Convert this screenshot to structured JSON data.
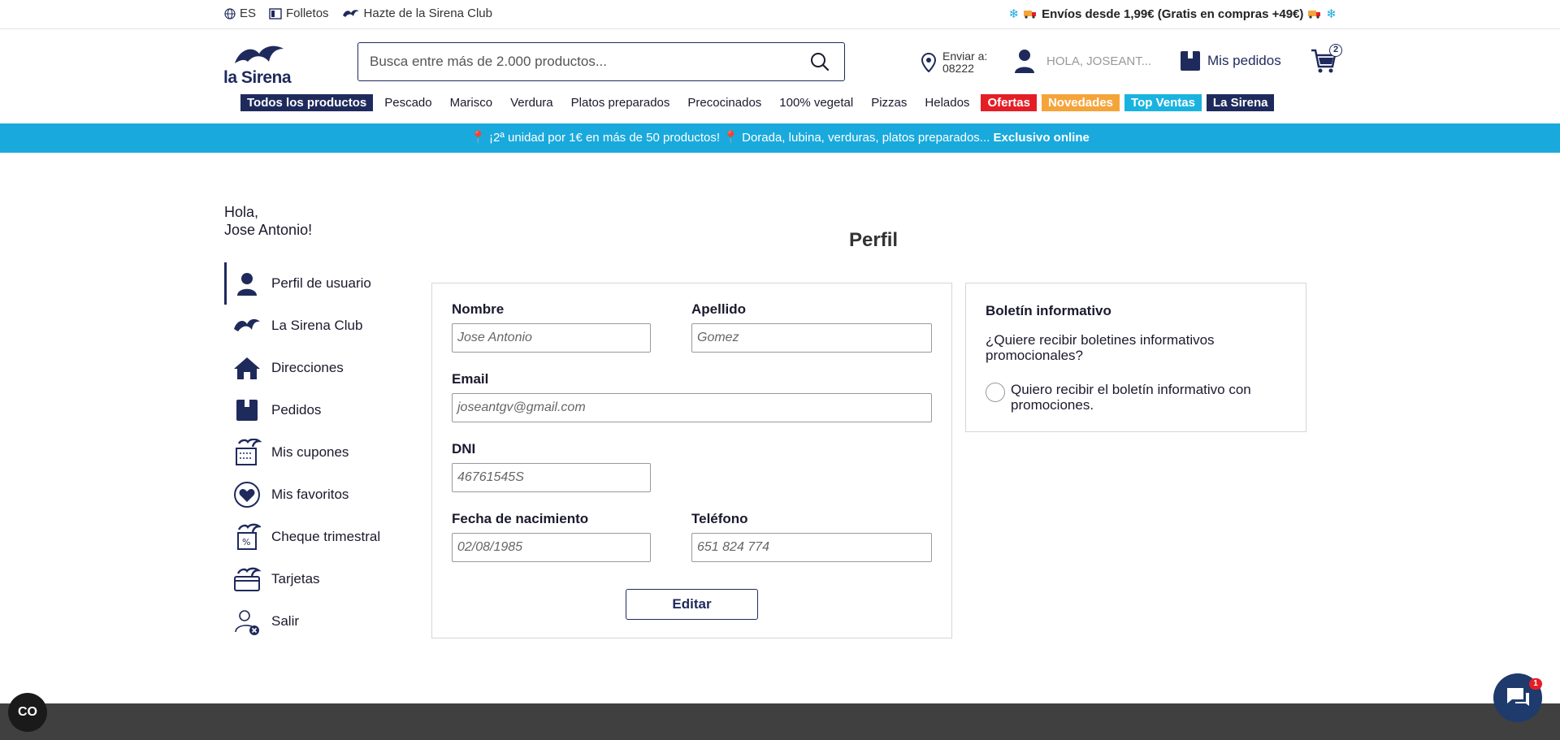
{
  "topbar": {
    "language": "ES",
    "folletos": "Folletos",
    "club_link": "Hazte de la Sirena Club",
    "shipping_prefix": "Envíos desde 1,99€ (Gratis en compras +49€)"
  },
  "header": {
    "logo_text": "la Sirena",
    "search_placeholder": "Busca entre más de 2.000 productos...",
    "ship_label": "Enviar a:",
    "ship_zip": "08222",
    "user_greeting": "HOLA, JOSEANT...",
    "orders_label": "Mis pedidos",
    "cart_count": "2"
  },
  "categories": [
    {
      "label": "Todos los productos",
      "style": "dark"
    },
    {
      "label": "Pescado",
      "style": "plain"
    },
    {
      "label": "Marisco",
      "style": "plain"
    },
    {
      "label": "Verdura",
      "style": "plain"
    },
    {
      "label": "Platos preparados",
      "style": "plain"
    },
    {
      "label": "Precocinados",
      "style": "plain"
    },
    {
      "label": "100% vegetal",
      "style": "plain"
    },
    {
      "label": "Pizzas",
      "style": "plain"
    },
    {
      "label": "Helados",
      "style": "plain"
    },
    {
      "label": "Ofertas",
      "style": "red"
    },
    {
      "label": "Novedades",
      "style": "orange"
    },
    {
      "label": "Top Ventas",
      "style": "cyan"
    },
    {
      "label": "La Sirena",
      "style": "dark"
    }
  ],
  "promo": {
    "text": "¡2ª unidad por 1€ en más de 50 productos!",
    "text2": "Dorada, lubina, verduras, platos preparados...",
    "bold": "Exclusivo online"
  },
  "sidebar": {
    "greeting_line1": "Hola,",
    "greeting_line2": "Jose Antonio!",
    "items": [
      {
        "label": "Perfil de usuario",
        "icon": "user-icon"
      },
      {
        "label": "La Sirena Club",
        "icon": "sirena-club-icon"
      },
      {
        "label": "Direcciones",
        "icon": "home-icon"
      },
      {
        "label": "Pedidos",
        "icon": "box-icon"
      },
      {
        "label": "Mis cupones",
        "icon": "coupon-icon"
      },
      {
        "label": "Mis favoritos",
        "icon": "heart-icon"
      },
      {
        "label": "Cheque trimestral",
        "icon": "cheque-icon"
      },
      {
        "label": "Tarjetas",
        "icon": "card-icon"
      },
      {
        "label": "Salir",
        "icon": "logout-icon"
      }
    ]
  },
  "profile": {
    "title": "Perfil",
    "nombre_label": "Nombre",
    "nombre_value": "Jose Antonio",
    "apellido_label": "Apellido",
    "apellido_value": "Gomez",
    "email_label": "Email",
    "email_value": "joseantgv@gmail.com",
    "dni_label": "DNI",
    "dni_value": "46761545S",
    "fecha_label": "Fecha de nacimiento",
    "fecha_value": "02/08/1985",
    "telefono_label": "Teléfono",
    "telefono_value": "651 824 774",
    "edit_button": "Editar"
  },
  "newsletter": {
    "title": "Boletín informativo",
    "question": "¿Quiere recibir boletines informativos promocionales?",
    "option": "Quiero recibir el boletín informativo con promociones."
  },
  "floating": {
    "co_label": "CO",
    "chat_badge": "1"
  },
  "colors": {
    "navy": "#1f2a5c",
    "promo_blue": "#1aa9dc",
    "offer_red": "#e41e26",
    "novedades_orange": "#f5a43a",
    "topventas_cyan": "#1ab3e0"
  }
}
